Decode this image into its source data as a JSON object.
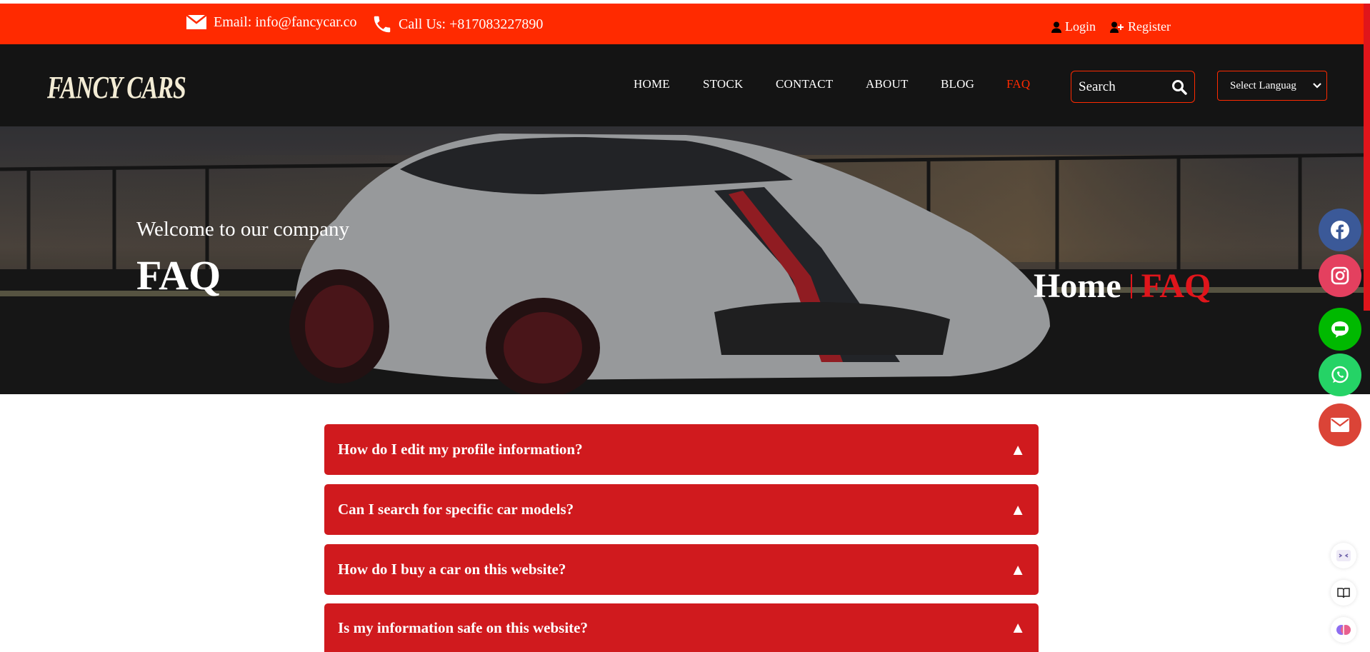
{
  "topbar": {
    "email": "Email: info@fancycar.co",
    "phone": "Call Us: +817083227890",
    "login": "Login",
    "register": "Register"
  },
  "navbar": {
    "logo_text": "FANCY CARS",
    "items": [
      "HOME",
      "STOCK",
      "CONTACT",
      "ABOUT",
      "BLOG",
      "FAQ"
    ],
    "active": "FAQ",
    "search_placeholder": "Search",
    "language": "Select Languag"
  },
  "hero": {
    "welcome": "Welcome to our company",
    "title": "FAQ",
    "breadcrumb_home": "Home",
    "breadcrumb_current": "FAQ"
  },
  "faq": [
    {
      "question": "How do I edit my profile information?",
      "arrow": "▲"
    },
    {
      "question": "Can I search for specific car models?",
      "arrow": "▲"
    },
    {
      "question": "How do I buy a car on this website?",
      "arrow": "▲"
    },
    {
      "question": "Is my information safe on this website?",
      "arrow": "▲"
    }
  ],
  "social": [
    {
      "name": "facebook-icon",
      "color": "#3b5998"
    },
    {
      "name": "instagram-icon",
      "color": "#e4405f"
    },
    {
      "name": "line-icon",
      "color": "#00b900"
    },
    {
      "name": "whatsapp-icon",
      "color": "#25d366"
    },
    {
      "name": "mail-icon",
      "color": "#db4437"
    }
  ],
  "colors": {
    "accent": "#ff2a00",
    "faq_bg": "#d01a1e",
    "nav_bg": "#141414"
  }
}
